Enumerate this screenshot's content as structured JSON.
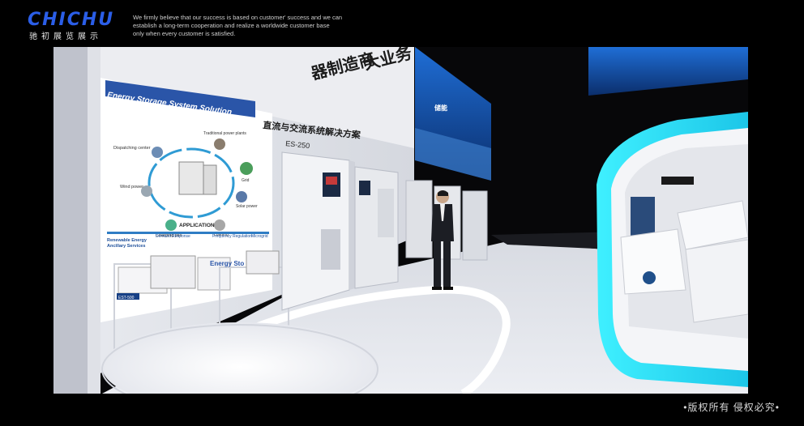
{
  "header": {
    "logo_text": "CHICHU",
    "logo_sub": "驰初展览展示",
    "tagline": [
      "We firmly believe that our success is based on customer' success and we can",
      "establish a long-term cooperation and realize a worldwide customer base",
      "only when every customer is satisfied."
    ]
  },
  "scene": {
    "wall_top_text": "器制造商",
    "wall_top_text2": "大业务",
    "panel_title": "Energy Storage System Solution",
    "panel_labels": {
      "dispatching": "Dispatching center",
      "traditional": "Traditional power plants",
      "grid": "Grid",
      "wind": "Wind power",
      "solar": "Solar power",
      "charging": "Charging pile",
      "loading": "Loading"
    },
    "application_title": "APPLICATION",
    "application_items": [
      "Renewable Energy",
      "Ancillary Services",
      "Demand Response",
      "Frequency Regulation",
      "Microgrid"
    ],
    "cabinet_headline": "直流与交流系统解决方案",
    "cabinet_model": "ES-250",
    "small_label": "Energy Sto",
    "plinth_label": "EST-500",
    "screen_text": "储能"
  },
  "footer": {
    "copyright": "•版权所有  侵权必究•"
  }
}
